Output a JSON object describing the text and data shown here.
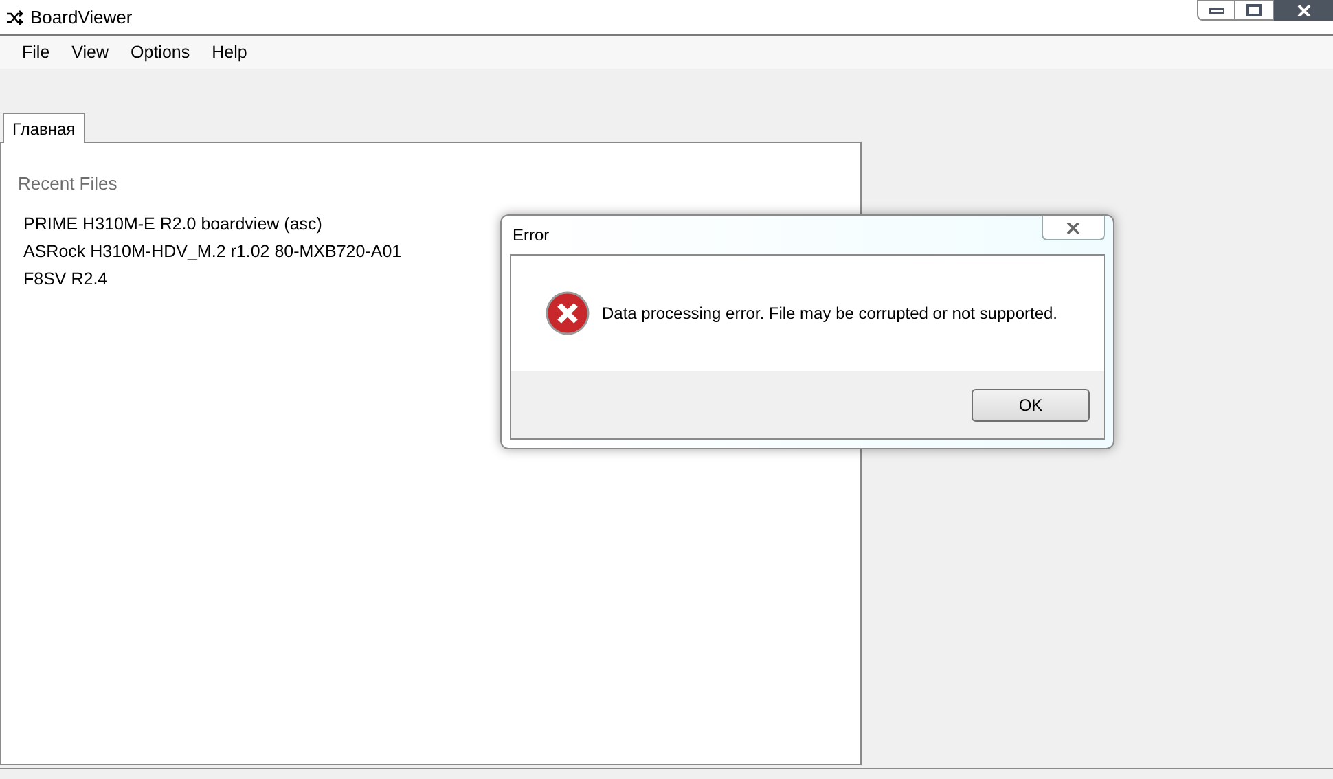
{
  "window": {
    "title": "BoardViewer"
  },
  "menu": [
    "File",
    "View",
    "Options",
    "Help"
  ],
  "tabs": [
    {
      "label": "Главная",
      "selected": true
    }
  ],
  "recent": {
    "heading": "Recent Files",
    "files": [
      "PRIME H310M-E R2.0 boardview (asc)",
      "ASRock H310M-HDV_M.2 r1.02 80-MXB720-A01",
      "F8SV R2.4"
    ]
  },
  "dialog": {
    "title": "Error",
    "message": "Data processing error. File may be corrupted or not supported.",
    "buttons": [
      "OK"
    ]
  }
}
